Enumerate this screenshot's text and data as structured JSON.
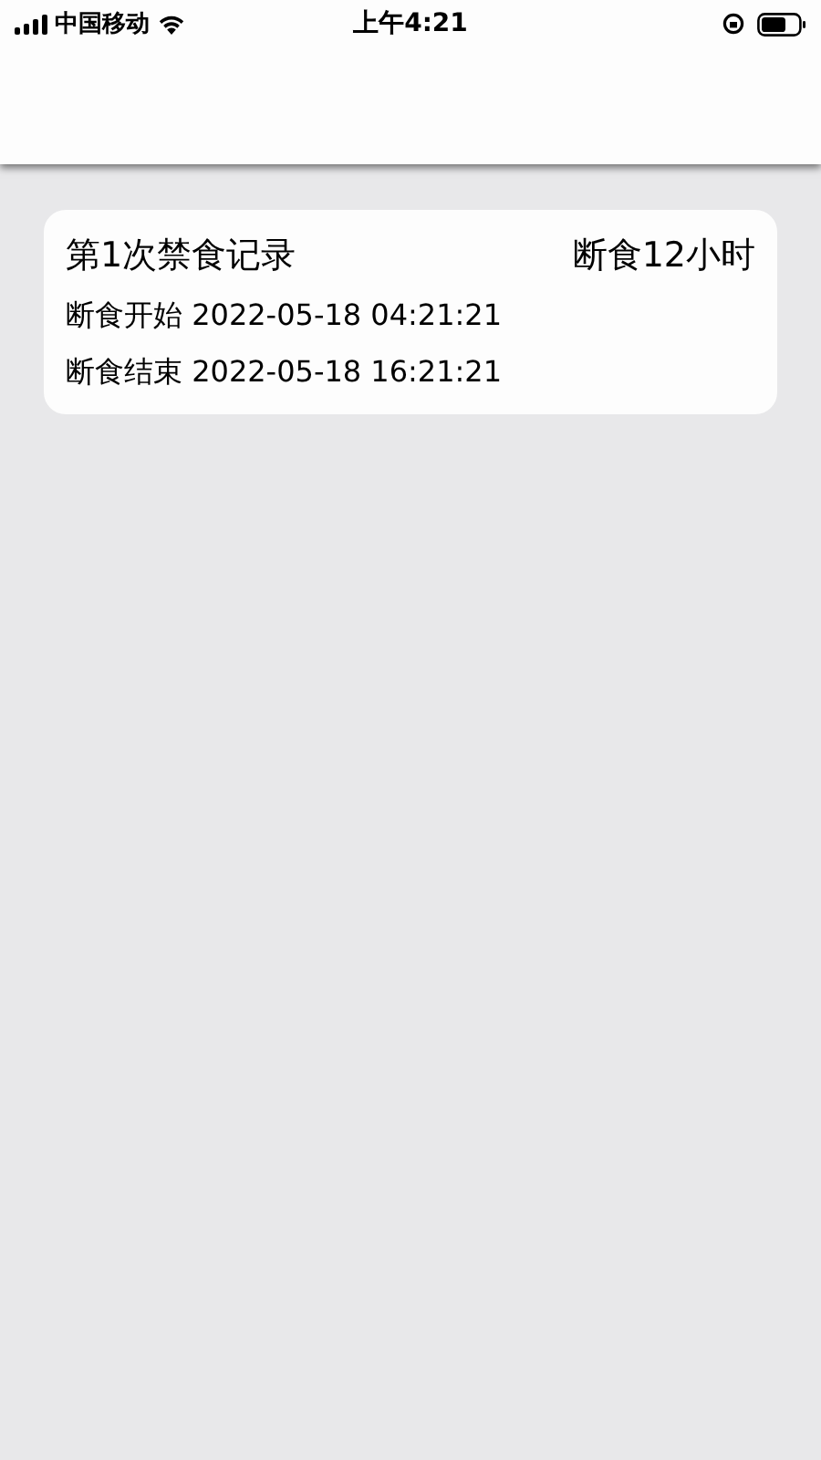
{
  "status_bar": {
    "carrier": "中国移动",
    "time": "上午4:21"
  },
  "records": [
    {
      "title": "第1次禁食记录",
      "duration": "断食12小时",
      "start": "断食开始 2022-05-18 04:21:21",
      "end": "断食结束 2022-05-18 16:21:21"
    }
  ]
}
